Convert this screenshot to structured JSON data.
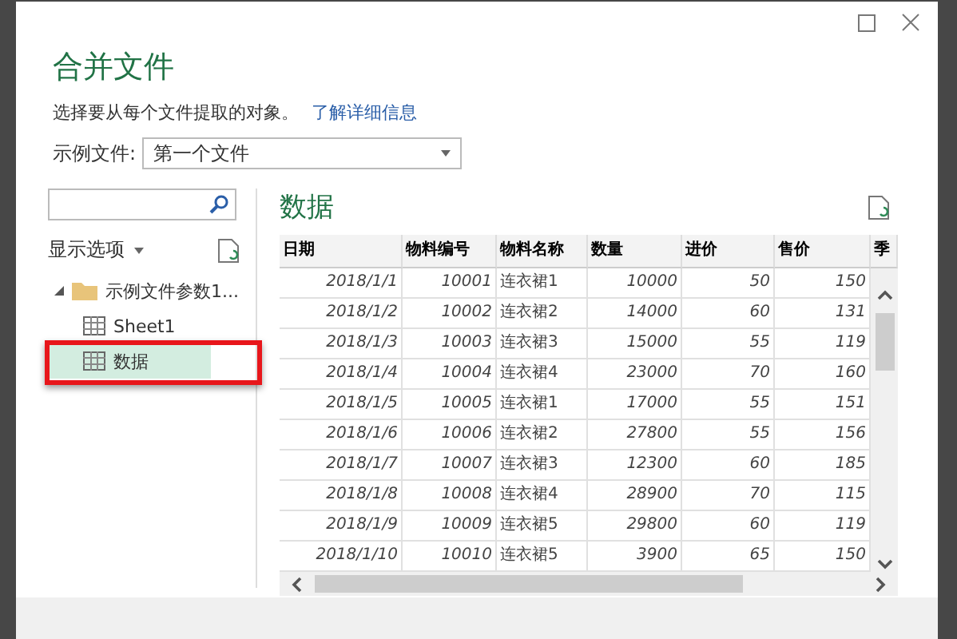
{
  "dialog": {
    "title": "合并文件",
    "description": "选择要从每个文件提取的对象。",
    "learn_more_link": "了解详细信息",
    "sample_file": {
      "label": "示例文件:",
      "value": "第一个文件"
    }
  },
  "navigator": {
    "display_options": "显示选项",
    "tree": [
      {
        "label": "示例文件参数1...",
        "kind": "folder",
        "expanded": true,
        "selected": false,
        "children": [
          {
            "label": "Sheet1",
            "kind": "sheet",
            "selected": false
          },
          {
            "label": "数据",
            "kind": "sheet",
            "selected": true
          }
        ]
      }
    ]
  },
  "preview": {
    "title": "数据",
    "table": {
      "columns": [
        {
          "heading": "日期",
          "kind": "number"
        },
        {
          "heading": "物料编号",
          "kind": "number"
        },
        {
          "heading": "物料名称",
          "kind": "text"
        },
        {
          "heading": "数量",
          "kind": "number"
        },
        {
          "heading": "进价",
          "kind": "number"
        },
        {
          "heading": "售价",
          "kind": "number"
        },
        {
          "heading": "季"
        }
      ],
      "rows": [
        [
          "2018/1/1",
          "10001",
          "连衣裙1",
          "10000",
          "50",
          "150"
        ],
        [
          "2018/1/2",
          "10002",
          "连衣裙2",
          "14000",
          "60",
          "131"
        ],
        [
          "2018/1/3",
          "10003",
          "连衣裙3",
          "15000",
          "55",
          "119"
        ],
        [
          "2018/1/4",
          "10004",
          "连衣裙4",
          "23000",
          "70",
          "160"
        ],
        [
          "2018/1/5",
          "10005",
          "连衣裙1",
          "17000",
          "55",
          "151"
        ],
        [
          "2018/1/6",
          "10006",
          "连衣裙2",
          "27800",
          "55",
          "156"
        ],
        [
          "2018/1/7",
          "10007",
          "连衣裙3",
          "12300",
          "60",
          "185"
        ],
        [
          "2018/1/8",
          "10008",
          "连衣裙4",
          "28900",
          "70",
          "115"
        ],
        [
          "2018/1/9",
          "10009",
          "连衣裙5",
          "29800",
          "60",
          "119"
        ],
        [
          "2018/1/10",
          "10010",
          "连衣裙5",
          "3900",
          "65",
          "150"
        ]
      ]
    }
  }
}
